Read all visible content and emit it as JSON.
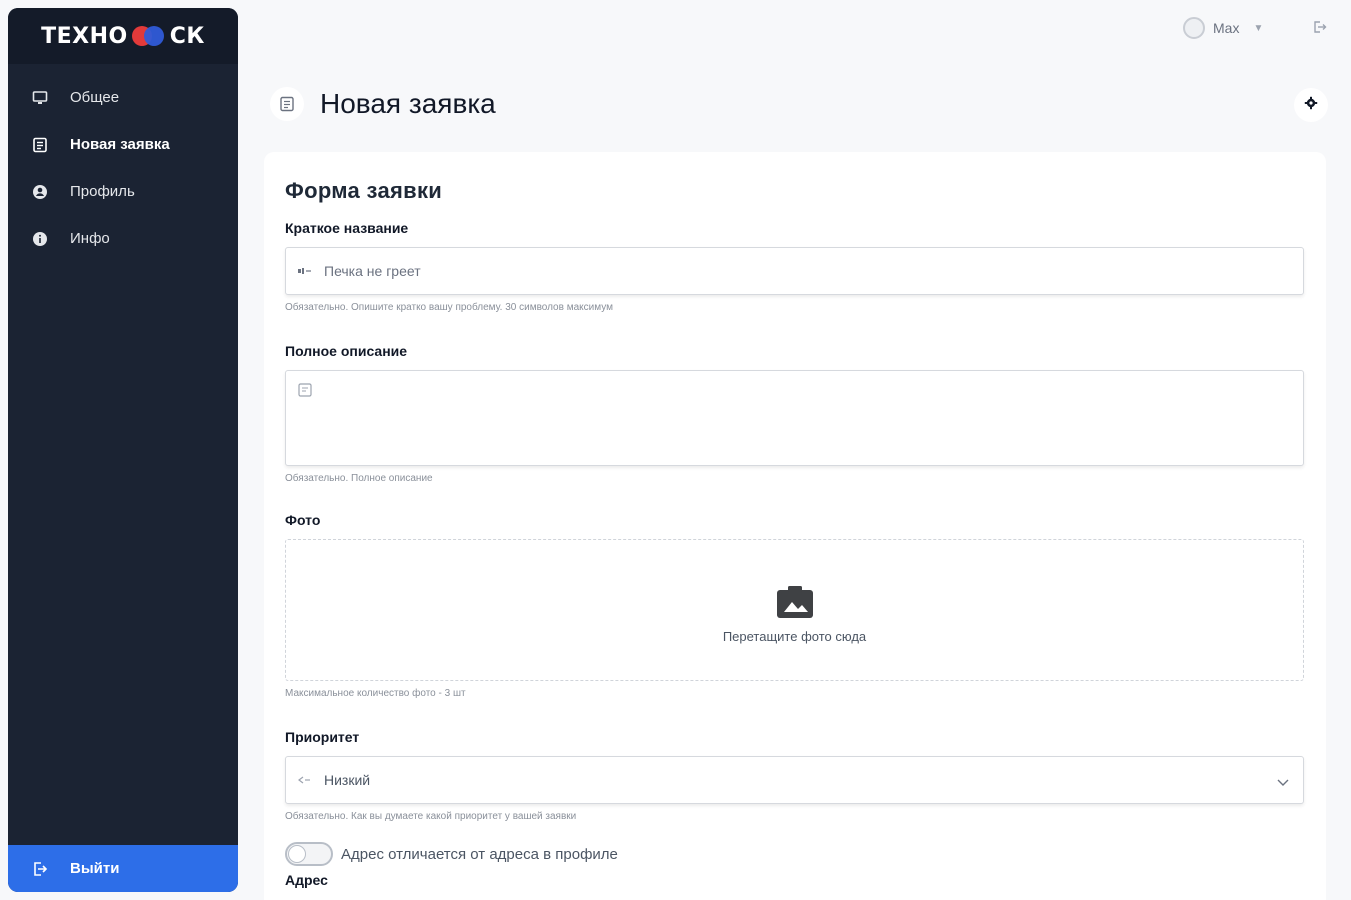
{
  "brand": {
    "left": "ТЕХНО",
    "right": "СК"
  },
  "sidebar": {
    "items": [
      {
        "label": "Общее",
        "icon": "monitor-icon"
      },
      {
        "label": "Новая заявка",
        "icon": "form-icon",
        "active": true
      },
      {
        "label": "Профиль",
        "icon": "user-circle-icon"
      },
      {
        "label": "Инфо",
        "icon": "info-icon"
      }
    ],
    "logout_label": "Выйти"
  },
  "topbar": {
    "user_name": "Max"
  },
  "page": {
    "title": "Новая заявка"
  },
  "form": {
    "title": "Форма заявки",
    "short_name": {
      "label": "Краткое название",
      "placeholder": "Печка не греет",
      "hint": "Обязательно. Опишите кратко вашу проблему. 30 символов максимум"
    },
    "full_description": {
      "label": "Полное описание",
      "hint": "Обязательно. Полное описание"
    },
    "photo": {
      "label": "Фото",
      "drop_text": "Перетащите фото сюда",
      "hint": "Максимальное количество фото - 3 шт"
    },
    "priority": {
      "label": "Приоритет",
      "value": "Низкий",
      "hint": "Обязательно. Как вы думаете какой приоритет у вашей заявки"
    },
    "address_toggle": {
      "label": "Адрес отличается от адреса в профиле",
      "on": false
    },
    "address": {
      "label": "Адрес"
    }
  },
  "colors": {
    "sidebar_bg": "#1b2333",
    "accent": "#2d6ee8",
    "logo_red": "#e23a3a",
    "logo_blue": "#2f5bd8"
  }
}
